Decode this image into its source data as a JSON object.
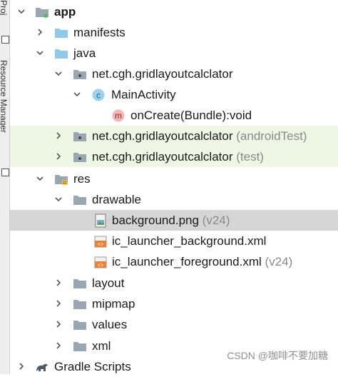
{
  "side_panel": {
    "top_tab_label": "Proj",
    "resource_manager_label": "Resource Manager"
  },
  "tree": [
    {
      "id": "app",
      "label": "app",
      "suffix": "",
      "icon": "module-folder-icon",
      "expanded": true
    },
    {
      "id": "manifests",
      "label": "manifests",
      "suffix": "",
      "icon": "folder-icon",
      "expanded": false
    },
    {
      "id": "java",
      "label": "java",
      "suffix": "",
      "icon": "folder-icon",
      "expanded": true
    },
    {
      "id": "pkg-main",
      "label": "net.cgh.gridlayoutcalclator",
      "suffix": "",
      "icon": "package-icon",
      "expanded": true
    },
    {
      "id": "mainactivity",
      "label": "MainActivity",
      "suffix": "",
      "icon": "class-icon",
      "expanded": true
    },
    {
      "id": "oncreate",
      "label": "onCreate(Bundle):void",
      "suffix": "",
      "icon": "method-icon",
      "expanded": null
    },
    {
      "id": "pkg-androidtest",
      "label": "net.cgh.gridlayoutcalclator",
      "suffix": "(androidTest)",
      "icon": "package-icon",
      "expanded": false
    },
    {
      "id": "pkg-test",
      "label": "net.cgh.gridlayoutcalclator",
      "suffix": "(test)",
      "icon": "package-icon",
      "expanded": false
    },
    {
      "id": "res",
      "label": "res",
      "suffix": "",
      "icon": "res-folder-icon",
      "expanded": true
    },
    {
      "id": "drawable",
      "label": "drawable",
      "suffix": "",
      "icon": "folder-icon",
      "expanded": true
    },
    {
      "id": "background-png",
      "label": "background.png",
      "suffix": "(v24)",
      "icon": "image-file-icon",
      "expanded": null
    },
    {
      "id": "ic-launcher-background",
      "label": "ic_launcher_background.xml",
      "suffix": "",
      "icon": "xml-file-icon",
      "expanded": null
    },
    {
      "id": "ic-launcher-foreground",
      "label": "ic_launcher_foreground.xml",
      "suffix": "(v24)",
      "icon": "xml-file-icon",
      "expanded": null
    },
    {
      "id": "layout",
      "label": "layout",
      "suffix": "",
      "icon": "folder-icon",
      "expanded": false
    },
    {
      "id": "mipmap",
      "label": "mipmap",
      "suffix": "",
      "icon": "folder-icon",
      "expanded": false
    },
    {
      "id": "values",
      "label": "values",
      "suffix": "",
      "icon": "folder-icon",
      "expanded": false
    },
    {
      "id": "xml",
      "label": "xml",
      "suffix": "",
      "icon": "folder-icon",
      "expanded": false
    },
    {
      "id": "gradle-scripts",
      "label": "Gradle Scripts",
      "suffix": "",
      "icon": "gradle-icon",
      "expanded": false
    }
  ],
  "selected_item": "background.png",
  "highlighted_rows": [
    "pkg-androidtest",
    "pkg-test"
  ],
  "colors": {
    "highlight_green": "#eef6e4",
    "selection_gray": "#d5d5d5",
    "folder_blue": "#8fc8e8",
    "suffix_gray": "#8a8a8a"
  },
  "watermark": "CSDN @咖啡不要加糖"
}
